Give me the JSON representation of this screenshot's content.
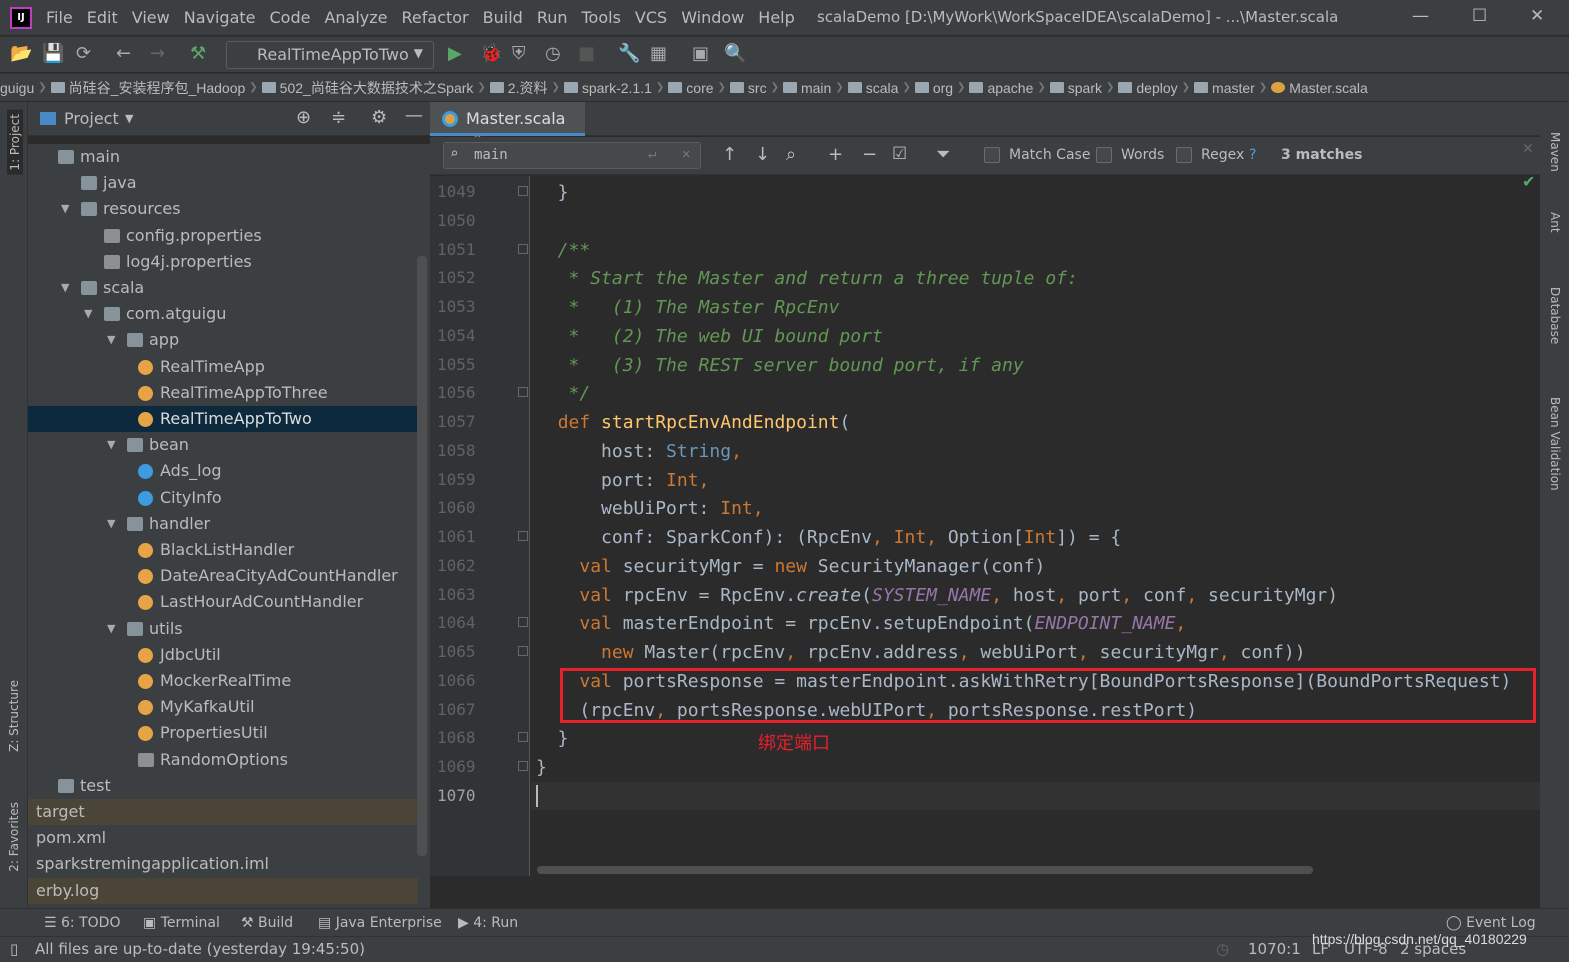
{
  "menu": [
    "File",
    "Edit",
    "View",
    "Navigate",
    "Code",
    "Analyze",
    "Refactor",
    "Build",
    "Run",
    "Tools",
    "VCS",
    "Window",
    "Help"
  ],
  "window_title": "scalaDemo [D:\\MyWork\\WorkSpaceIDEA\\scalaDemo] - ...\\Master.scala",
  "toolbar": {
    "run_config": "RealTimeAppToTwo"
  },
  "breadcrumbs": [
    "guigu",
    "尚硅谷_安装程序包_Hadoop",
    "502_尚硅谷大数据技术之Spark",
    "2.资料",
    "spark-2.1.1",
    "core",
    "src",
    "main",
    "scala",
    "org",
    "apache",
    "spark",
    "deploy",
    "master",
    "Master.scala"
  ],
  "left_stripe": {
    "project": "1: Project",
    "structure": "Z: Structure",
    "favorites": "2: Favorites"
  },
  "project_panel": {
    "title": "Project",
    "tree": [
      {
        "label": "main",
        "level": 0,
        "icon": "folder",
        "arrow": ""
      },
      {
        "label": "java",
        "level": 1,
        "icon": "folder",
        "arrow": ""
      },
      {
        "label": "resources",
        "level": 1,
        "icon": "folder",
        "arrow": "down"
      },
      {
        "label": "config.properties",
        "level": 2,
        "icon": "properties",
        "arrow": ""
      },
      {
        "label": "log4j.properties",
        "level": 2,
        "icon": "properties",
        "arrow": ""
      },
      {
        "label": "scala",
        "level": 1,
        "icon": "folder",
        "arrow": "down"
      },
      {
        "label": "com.atguigu",
        "level": 2,
        "icon": "folder",
        "arrow": "down"
      },
      {
        "label": "app",
        "level": 3,
        "icon": "folder",
        "arrow": "down"
      },
      {
        "label": "RealTimeApp",
        "level": 4,
        "icon": "object",
        "arrow": ""
      },
      {
        "label": "RealTimeAppToThree",
        "level": 4,
        "icon": "object",
        "arrow": ""
      },
      {
        "label": "RealTimeAppToTwo",
        "level": 4,
        "icon": "object",
        "arrow": "",
        "selected": true
      },
      {
        "label": "bean",
        "level": 3,
        "icon": "folder",
        "arrow": "down"
      },
      {
        "label": "Ads_log",
        "level": 4,
        "icon": "class",
        "arrow": ""
      },
      {
        "label": "CityInfo",
        "level": 4,
        "icon": "class",
        "arrow": ""
      },
      {
        "label": "handler",
        "level": 3,
        "icon": "folder",
        "arrow": "down"
      },
      {
        "label": "BlackListHandler",
        "level": 4,
        "icon": "object",
        "arrow": ""
      },
      {
        "label": "DateAreaCityAdCountHandler",
        "level": 4,
        "icon": "object",
        "arrow": ""
      },
      {
        "label": "LastHourAdCountHandler",
        "level": 4,
        "icon": "object",
        "arrow": ""
      },
      {
        "label": "utils",
        "level": 3,
        "icon": "folder",
        "arrow": "down"
      },
      {
        "label": "JdbcUtil",
        "level": 4,
        "icon": "object",
        "arrow": ""
      },
      {
        "label": "MockerRealTime",
        "level": 4,
        "icon": "object",
        "arrow": ""
      },
      {
        "label": "MyKafkaUtil",
        "level": 4,
        "icon": "object",
        "arrow": ""
      },
      {
        "label": "PropertiesUtil",
        "level": 4,
        "icon": "object",
        "arrow": ""
      },
      {
        "label": "RandomOptions",
        "level": 4,
        "icon": "class-file",
        "arrow": ""
      },
      {
        "label": "test",
        "level": 0,
        "icon": "folder",
        "arrow": ""
      },
      {
        "label": "target",
        "level": -1,
        "icon": "",
        "arrow": "",
        "excluded": true
      },
      {
        "label": "pom.xml",
        "level": -1,
        "icon": "",
        "arrow": ""
      },
      {
        "label": "sparkstremingapplication.iml",
        "level": -1,
        "icon": "",
        "arrow": ""
      },
      {
        "label": "erby.log",
        "level": -1,
        "icon": "",
        "arrow": "",
        "excluded": true
      }
    ]
  },
  "editor": {
    "tab": "Master.scala",
    "find": {
      "query": "main",
      "match_case": "Match Case",
      "words": "Words",
      "regex": "Regex",
      "help": "?",
      "matches": "3 matches"
    },
    "lines": [
      {
        "n": "1049",
        "tokens": [
          [
            "  }",
            ""
          ]
        ]
      },
      {
        "n": "1050",
        "tokens": []
      },
      {
        "n": "1051",
        "tokens": [
          [
            "  /**",
            "cm"
          ]
        ]
      },
      {
        "n": "1052",
        "tokens": [
          [
            "   * Start the Master and return a three tuple of:",
            "cm"
          ]
        ]
      },
      {
        "n": "1053",
        "tokens": [
          [
            "   *   (1) The Master RpcEnv",
            "cm"
          ]
        ]
      },
      {
        "n": "1054",
        "tokens": [
          [
            "   *   (2) The web UI bound port",
            "cm"
          ]
        ]
      },
      {
        "n": "1055",
        "tokens": [
          [
            "   *   (3) The REST server bound port, if any",
            "cm"
          ]
        ]
      },
      {
        "n": "1056",
        "tokens": [
          [
            "   */",
            "cm"
          ]
        ]
      },
      {
        "n": "1057",
        "tokens": [
          [
            "  ",
            ""
          ],
          [
            "def ",
            "kw"
          ],
          [
            "startRpcEnvAndEndpoint",
            "fn"
          ],
          [
            "(",
            ""
          ]
        ]
      },
      {
        "n": "1058",
        "tokens": [
          [
            "      host: ",
            ""
          ],
          [
            "String",
            "ty"
          ],
          [
            ",",
            "kw"
          ]
        ]
      },
      {
        "n": "1059",
        "tokens": [
          [
            "      port: ",
            ""
          ],
          [
            "Int",
            "kw"
          ],
          [
            ",",
            "kw"
          ]
        ]
      },
      {
        "n": "1060",
        "tokens": [
          [
            "      webUiPort: ",
            ""
          ],
          [
            "Int",
            "kw"
          ],
          [
            ",",
            "kw"
          ]
        ]
      },
      {
        "n": "1061",
        "tokens": [
          [
            "      conf: SparkConf): (RpcEnv",
            ""
          ],
          [
            ", ",
            "kw"
          ],
          [
            "Int",
            "kw"
          ],
          [
            ", ",
            "kw"
          ],
          [
            "Option[",
            ""
          ],
          [
            "Int",
            "kw"
          ],
          [
            "]) = {",
            ""
          ]
        ]
      },
      {
        "n": "1062",
        "tokens": [
          [
            "    ",
            ""
          ],
          [
            "val ",
            "kw"
          ],
          [
            "securityMgr = ",
            ""
          ],
          [
            "new ",
            "kw"
          ],
          [
            "SecurityManager(conf)",
            ""
          ]
        ]
      },
      {
        "n": "1063",
        "tokens": [
          [
            "    ",
            ""
          ],
          [
            "val ",
            "kw"
          ],
          [
            "rpcEnv = RpcEnv.",
            ""
          ],
          [
            "create",
            "it"
          ],
          [
            "(",
            ""
          ],
          [
            "SYSTEM_NAME",
            "cn"
          ],
          [
            ", ",
            "kw"
          ],
          [
            "host",
            ""
          ],
          [
            ", ",
            "kw"
          ],
          [
            "port",
            ""
          ],
          [
            ", ",
            "kw"
          ],
          [
            "conf",
            ""
          ],
          [
            ", ",
            "kw"
          ],
          [
            "securityMgr)",
            ""
          ]
        ]
      },
      {
        "n": "1064",
        "tokens": [
          [
            "    ",
            ""
          ],
          [
            "val ",
            "kw"
          ],
          [
            "masterEndpoint = rpcEnv.setupEndpoint(",
            ""
          ],
          [
            "ENDPOINT_NAME",
            "cn"
          ],
          [
            ",",
            "kw"
          ]
        ]
      },
      {
        "n": "1065",
        "tokens": [
          [
            "      ",
            ""
          ],
          [
            "new ",
            "kw"
          ],
          [
            "Master(rpcEnv",
            ""
          ],
          [
            ", ",
            "kw"
          ],
          [
            "rpcEnv.address",
            ""
          ],
          [
            ", ",
            "kw"
          ],
          [
            "webUiPort",
            ""
          ],
          [
            ", ",
            "kw"
          ],
          [
            "securityMgr",
            ""
          ],
          [
            ", ",
            "kw"
          ],
          [
            "conf))",
            ""
          ]
        ]
      },
      {
        "n": "1066",
        "tokens": [
          [
            "    ",
            ""
          ],
          [
            "val ",
            "kw"
          ],
          [
            "portsResponse = masterEndpoint.askWithRetry[BoundPortsResponse](BoundPortsRequest)",
            ""
          ]
        ]
      },
      {
        "n": "1067",
        "tokens": [
          [
            "    (rpcEnv",
            ""
          ],
          [
            ", ",
            "kw"
          ],
          [
            "portsResponse.webUIPort",
            ""
          ],
          [
            ", ",
            "kw"
          ],
          [
            "portsResponse.restPort)",
            ""
          ]
        ]
      },
      {
        "n": "1068",
        "tokens": [
          [
            "  }",
            ""
          ]
        ]
      },
      {
        "n": "1069",
        "tokens": [
          [
            "}",
            ""
          ]
        ]
      },
      {
        "n": "1070",
        "tokens": []
      }
    ],
    "annotation": "绑定端口"
  },
  "right_stripe": [
    "Maven",
    "Ant",
    "Database",
    "Bean Validation"
  ],
  "bottom_tools": {
    "todo": "6: TODO",
    "terminal": "Terminal",
    "build": "Build",
    "java_enterprise": "Java Enterprise",
    "run": "4: Run",
    "event_log": "Event Log"
  },
  "status": {
    "message": "All files are up-to-date (yesterday 19:45:50)",
    "position": "1070:1",
    "line_sep": "LF",
    "encoding": "UTF-8",
    "indent": "2 spaces",
    "watermark": "https://blog.csdn.net/qq_40180229"
  },
  "colors": {
    "accent": "#4a88c7",
    "highlight_box": "#e8202a",
    "keyword": "#cc7832",
    "comment": "#629755"
  }
}
